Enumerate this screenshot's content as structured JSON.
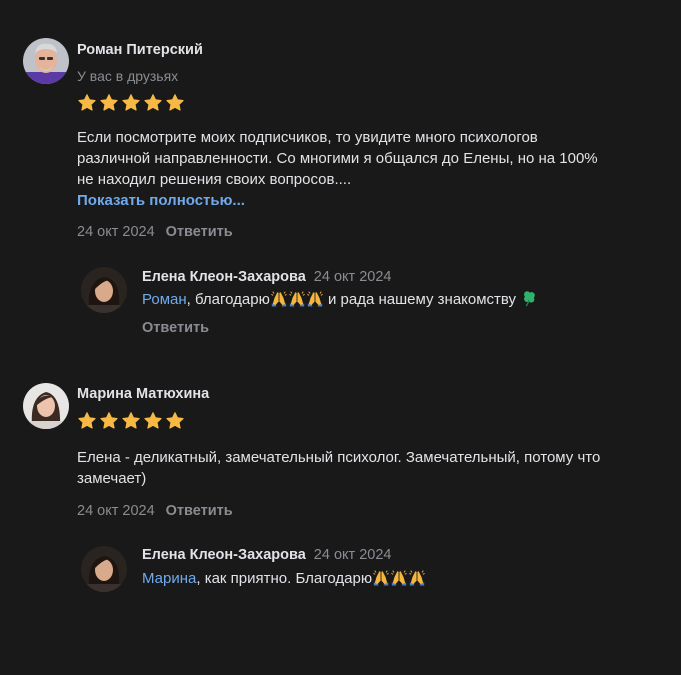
{
  "reviews": [
    {
      "author": "Роман Питерский",
      "subtitle": "У вас в друзьях",
      "rating": 5,
      "text_lines": [
        "Если посмотрите моих подписчиков, то увидите много психологов",
        "различной направленности. Со многими я общался до Елены, но на 100%",
        "не находил решения своих вопросов...."
      ],
      "show_more_label": "Показать полностью...",
      "date": "24 окт 2024",
      "reply_label": "Ответить",
      "reply": {
        "author": "Елена Клеон-Захарова",
        "date": "24 окт 2024",
        "mention": "Роман",
        "text_before_emoji": ", благодарю",
        "text_after_emoji": " и рада нашему знакомству ",
        "reply_label": "Ответить"
      }
    },
    {
      "author": "Марина Матюхина",
      "rating": 5,
      "text_lines": [
        "Елена - деликатный, замечательный психолог. Замечательный, потому что",
        "замечает)"
      ],
      "date": "24 окт 2024",
      "reply_label": "Ответить",
      "reply": {
        "author": "Елена Клеон-Захарова",
        "date": "24 окт 2024",
        "mention": "Марина",
        "text": ", как приятно. Благодарю"
      }
    }
  ],
  "colors": {
    "background": "#19191a",
    "text": "#e1e3e6",
    "secondary": "#8a8c91",
    "link": "#71aaeb",
    "star": "#f7b844"
  },
  "icons": [
    "star-icon",
    "praying-hands-emoji",
    "clover-emoji"
  ]
}
